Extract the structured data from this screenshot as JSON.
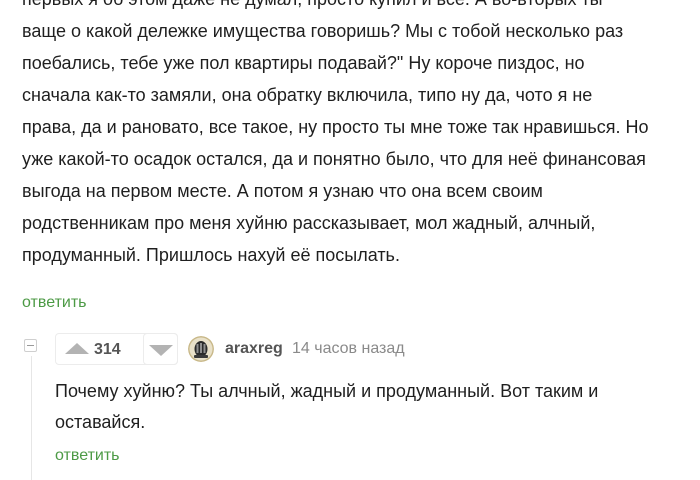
{
  "parent_comment": {
    "lines": [
      "первых я об этом даже не думал, просто купил и всё. А во-вторых ты",
      "ваще о какой дележке имущества говоришь? Мы с тобой несколько раз",
      "поебались, тебе уже пол квартиры подавай?\" Ну короче пиздос, но",
      "сначала как-то замяли, она обратку включила, типо ну да, чото я не",
      "права, да и рановато, все такое, ну просто ты мне тоже так нравишься. Но",
      "уже какой-то осадок остался, да и понятно было, что для неё финансовая",
      "выгода на первом месте. А потом я узнаю что она всем своим",
      "родственникам про меня хуйню рассказывает, мол жадный, алчный,",
      "продуманный. Пришлось нахуй её посылать."
    ],
    "reply_label": "ответить"
  },
  "child_comment": {
    "rating": "314",
    "author": "araxreg",
    "timestamp": "14 часов назад",
    "lines": [
      "Почему хуйню? Ты алчный, жадный и продуманный. Вот таким и",
      "оставайся."
    ],
    "reply_label": "ответить"
  },
  "colors": {
    "link": "#4c9a45",
    "text": "#1f1f1f",
    "muted": "#8a8a8a",
    "vote_arrow": "#b3b3b3"
  },
  "icons": {
    "vote_up": "vote-up-icon",
    "vote_down": "vote-down-icon",
    "collapse": "collapse-thread-icon",
    "avatar": "user-avatar"
  }
}
